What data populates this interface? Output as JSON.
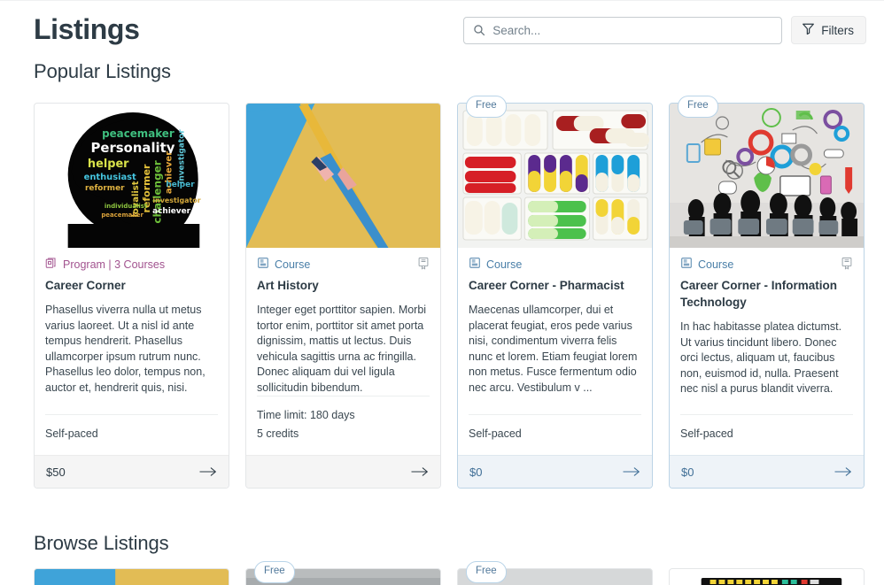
{
  "header": {
    "title": "Listings",
    "search": {
      "placeholder": "Search...",
      "value": "",
      "icon": "search-icon"
    },
    "filters": {
      "label": "Filters",
      "icon": "filter-icon"
    }
  },
  "sections": [
    {
      "id": "popular",
      "heading": "Popular Listings"
    },
    {
      "id": "browse",
      "heading": "Browse Listings"
    }
  ],
  "colors": {
    "program_accent": "#a2538f",
    "course_accent": "#4a7fa8",
    "free_badge_text": "#50789a",
    "free_badge_border": "#b9d4e8",
    "highlight_border": "#bcd4e6",
    "highlight_footer_bg": "#eef3f8",
    "default_footer_bg": "#f5f5f5",
    "text": "#2d3b45"
  },
  "popular_listings": [
    {
      "kicker": "Program | 3 Courses",
      "kicker_type": "program",
      "kicker_icon": "program-icon",
      "title": "Career Corner",
      "description": "Phasellus viverra nulla ut metus varius laoreet. Ut a nisl id ante tempus hendrerit. Phasellus ullamcorper ipsum rutrum nunc. Phasellus leo dolor, tempus non, auctor et, hendrerit quis, nisi.",
      "meta": [
        "Self-paced"
      ],
      "price": "$50",
      "free_badge": "",
      "certificate": false,
      "highlight": false,
      "arrow_icon": "arrow-right-icon",
      "image_alt": "head-silhouette-word-cloud"
    },
    {
      "kicker": "Course",
      "kicker_type": "course",
      "kicker_icon": "course-icon",
      "title": "Art History",
      "description": "Integer eget porttitor sapien. Morbi tortor enim, porttitor sit amet porta dignissim, mattis ut lectus. Duis vehicula sagittis urna ac fringilla. Donec aliquam dui vel ligula sollicitudin bibendum.",
      "meta": [
        "Time limit: 180 days",
        "5 credits"
      ],
      "price": "",
      "free_badge": "",
      "certificate": true,
      "highlight": false,
      "arrow_icon": "arrow-right-icon",
      "image_alt": "pencils-blue-yellow"
    },
    {
      "kicker": "Course",
      "kicker_type": "course",
      "kicker_icon": "course-icon",
      "title": "Career Corner - Pharmacist",
      "description": "Maecenas ullamcorper, dui et placerat feugiat, eros pede varius nisi, condimentum viverra felis nunc et lorem. Etiam feugiat lorem non metus. Fusce fermentum odio nec arcu. Vestibulum v ...",
      "meta": [
        "Self-paced"
      ],
      "price": "$0",
      "free_badge": "Free",
      "certificate": false,
      "highlight": true,
      "arrow_icon": "arrow-right-icon",
      "image_alt": "pill-capsules-tray"
    },
    {
      "kicker": "Course",
      "kicker_type": "course",
      "kicker_icon": "course-icon",
      "title": "Career Corner - Information Technology",
      "description": "In hac habitasse platea dictumst. Ut varius tincidunt libero. Donec orci lectus, aliquam ut, faucibus non, euismod id, nulla. Praesent nec nisl a purus blandit viverra.",
      "meta": [
        "Self-paced"
      ],
      "price": "$0",
      "free_badge": "Free",
      "certificate": true,
      "highlight": true,
      "arrow_icon": "arrow-right-icon",
      "image_alt": "business-meeting-tech-icons"
    }
  ],
  "browse_listings": [
    {
      "free_badge": "",
      "highlight": false,
      "image_alt": "blue-yellow-stripe"
    },
    {
      "free_badge": "Free",
      "highlight": false,
      "image_alt": "classroom-photo"
    },
    {
      "free_badge": "Free",
      "highlight": false,
      "image_alt": "gray-photo"
    },
    {
      "free_badge": "",
      "highlight": false,
      "image_alt": "keyboard-photo"
    }
  ]
}
